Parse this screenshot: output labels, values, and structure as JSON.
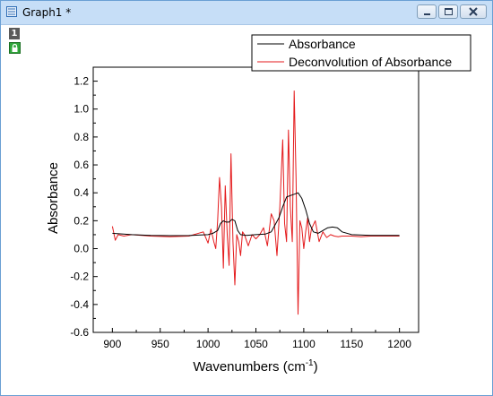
{
  "window": {
    "title": "Graph1 *",
    "layer_number": "1",
    "icons": {
      "title": "graph-window-icon",
      "minimize": "minimize-icon",
      "maximize": "maximize-icon",
      "close": "close-icon",
      "lock": "lock-icon"
    }
  },
  "chart_data": {
    "type": "line",
    "title": "",
    "xlabel": "Wavenumbers (cm",
    "xlabel_sup": "-1",
    "xlabel_suffix": ")",
    "ylabel": "Absorbance",
    "xlim": [
      880,
      1220
    ],
    "ylim": [
      -0.6,
      1.3
    ],
    "xticks": [
      900,
      950,
      1000,
      1050,
      1100,
      1150,
      1200
    ],
    "yticks": [
      -0.6,
      -0.4,
      -0.2,
      0.0,
      0.2,
      0.4,
      0.6,
      0.8,
      1.0,
      1.2
    ],
    "ytick_labels": [
      "-0.6",
      "-0.4",
      "-0.2",
      "0.0",
      "0.2",
      "0.4",
      "0.6",
      "0.8",
      "1.0",
      "1.2"
    ],
    "legend_position": "top-right",
    "series": [
      {
        "name": "Absorbance",
        "color": "#000000",
        "x": [
          900,
          920,
          940,
          960,
          980,
          1000,
          1005,
          1010,
          1013,
          1016,
          1019,
          1022,
          1025,
          1028,
          1031,
          1034,
          1040,
          1050,
          1060,
          1066,
          1070,
          1074,
          1078,
          1082,
          1086,
          1090,
          1094,
          1098,
          1102,
          1106,
          1110,
          1115,
          1120,
          1125,
          1130,
          1135,
          1140,
          1150,
          1170,
          1200
        ],
        "values": [
          0.11,
          0.1,
          0.095,
          0.093,
          0.094,
          0.1,
          0.11,
          0.13,
          0.18,
          0.2,
          0.19,
          0.19,
          0.21,
          0.2,
          0.13,
          0.1,
          0.095,
          0.1,
          0.105,
          0.12,
          0.17,
          0.22,
          0.3,
          0.37,
          0.38,
          0.39,
          0.4,
          0.36,
          0.28,
          0.18,
          0.12,
          0.11,
          0.13,
          0.15,
          0.155,
          0.15,
          0.12,
          0.1,
          0.095,
          0.095
        ]
      },
      {
        "name": "Deconvolution of Absorbance",
        "color": "#e41a1c",
        "x": [
          900,
          903,
          906,
          912,
          920,
          940,
          960,
          980,
          995,
          1000,
          1003,
          1006,
          1008,
          1010,
          1012,
          1014,
          1016,
          1018,
          1020,
          1022,
          1024,
          1026,
          1028,
          1030,
          1032,
          1034,
          1036,
          1038,
          1042,
          1046,
          1050,
          1054,
          1058,
          1062,
          1066,
          1069,
          1072,
          1075,
          1078,
          1080,
          1082,
          1084,
          1086,
          1088,
          1090,
          1092,
          1094,
          1096,
          1098,
          1100,
          1102,
          1104,
          1106,
          1108,
          1112,
          1116,
          1120,
          1124,
          1128,
          1132,
          1136,
          1140,
          1150,
          1160,
          1170,
          1180,
          1200
        ],
        "values": [
          0.16,
          0.06,
          0.1,
          0.09,
          0.1,
          0.09,
          0.085,
          0.09,
          0.12,
          0.04,
          0.14,
          0.05,
          0.0,
          0.2,
          0.51,
          0.3,
          -0.14,
          0.45,
          0.1,
          -0.12,
          0.68,
          0.05,
          -0.26,
          0.1,
          0.05,
          -0.05,
          0.12,
          0.1,
          0.02,
          0.1,
          0.07,
          0.1,
          0.15,
          0.02,
          0.25,
          0.2,
          -0.05,
          0.3,
          0.78,
          0.18,
          0.05,
          0.85,
          0.3,
          0.05,
          1.13,
          0.5,
          -0.47,
          0.2,
          0.15,
          0.0,
          0.12,
          0.22,
          0.05,
          0.14,
          0.2,
          0.05,
          0.12,
          0.08,
          0.1,
          0.09,
          0.085,
          0.09,
          0.09,
          0.085,
          0.09,
          0.09,
          0.09
        ]
      }
    ]
  }
}
